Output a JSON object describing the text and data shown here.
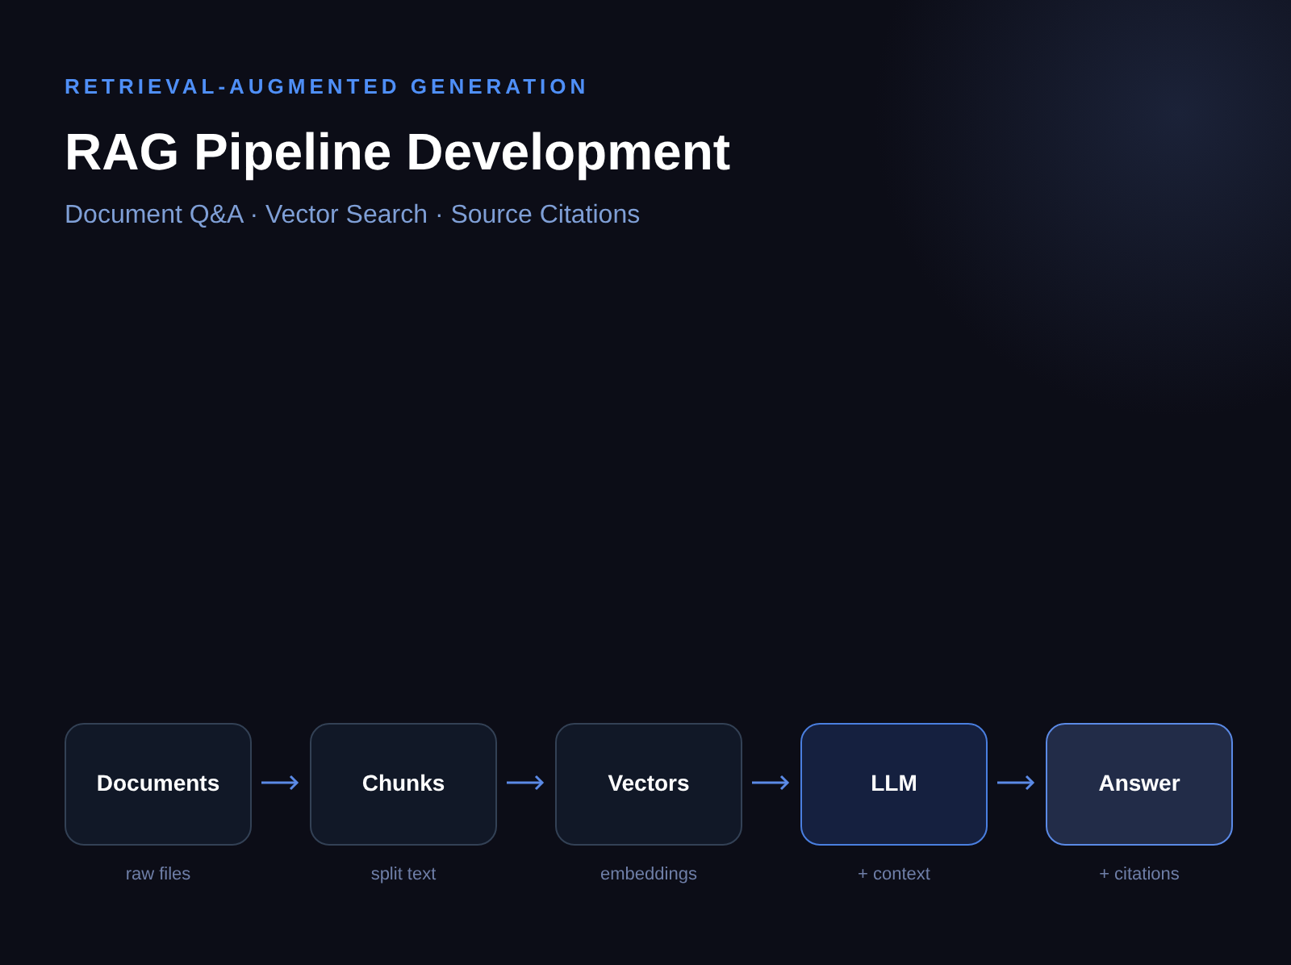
{
  "eyebrow": "RETRIEVAL-AUGMENTED GENERATION",
  "title": "RAG Pipeline Development",
  "subtitle": "Document Q&A · Vector Search · Source Citations",
  "stages": [
    {
      "label": "Documents",
      "caption": "raw files",
      "kind": "plain"
    },
    {
      "label": "Chunks",
      "caption": "split text",
      "kind": "plain"
    },
    {
      "label": "Vectors",
      "caption": "embeddings",
      "kind": "plain"
    },
    {
      "label": "LLM",
      "caption": "+ context",
      "kind": "model"
    },
    {
      "label": "Answer",
      "caption": "+ citations",
      "kind": "output"
    }
  ]
}
